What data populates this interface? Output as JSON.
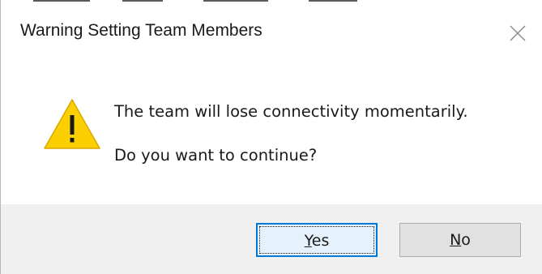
{
  "dialog": {
    "title": "Warning Setting Team Members",
    "close_icon": "close-icon",
    "warning_icon": "warning-triangle-icon",
    "message_line1": "The team will lose connectivity momentarily.",
    "message_line2": "Do you want to continue?"
  },
  "buttons": {
    "yes_mnemonic": "Y",
    "yes_rest": "es",
    "no_mnemonic": "N",
    "no_rest": "o"
  },
  "colors": {
    "accent": "#0078d7",
    "warning_fill": "#fcd000",
    "footer_bg": "#f0f0f0"
  }
}
